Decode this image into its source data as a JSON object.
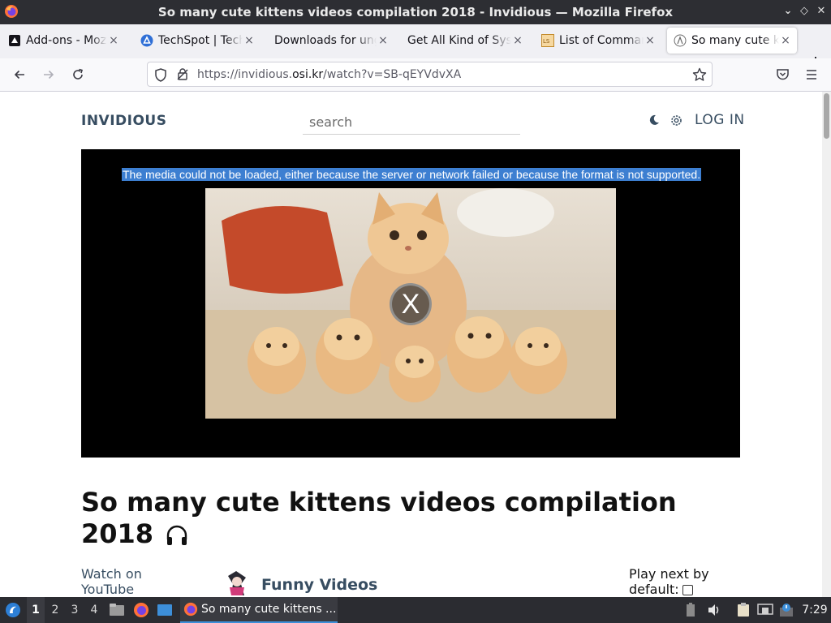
{
  "window": {
    "title": "So many cute kittens videos compilation 2018 - Invidious — Mozilla Firefox",
    "minimize": "⌄",
    "restore": "◇",
    "close": "✕"
  },
  "tabs": [
    {
      "label": "Add-ons - Mozilla",
      "icon": "addons-icon",
      "active": false
    },
    {
      "label": "TechSpot | Technology",
      "icon": "techspot-icon",
      "active": false
    },
    {
      "label": "Downloads for ungoogled",
      "icon": "none",
      "active": false
    },
    {
      "label": "Get All Kind of System",
      "icon": "none",
      "active": false
    },
    {
      "label": "List of Commands",
      "icon": "ls-icon",
      "active": false
    },
    {
      "label": "So many cute kittens",
      "icon": "invidious-icon",
      "active": true
    }
  ],
  "tab_close_glyph": "×",
  "new_tab": "+",
  "navbar": {
    "url_prefix": "https://invidious.",
    "url_domain": "osi.kr",
    "url_suffix": "/watch?v=SB-qEYVdvXA"
  },
  "site": {
    "logo": "INVIDIOUS",
    "search_placeholder": "search",
    "login": "LOG IN"
  },
  "player": {
    "error_message": "The media could not be loaded, either because the server or network failed or because the format is not supported.",
    "error_glyph": "X"
  },
  "video": {
    "title": "So many cute kittens videos compilation 2018",
    "watch_on_youtube": "Watch on YouTube",
    "channel_name": "Funny Videos",
    "play_next_label": "Play next by default:"
  },
  "taskbar": {
    "workspaces": [
      "1",
      "2",
      "3",
      "4"
    ],
    "active_workspace": 0,
    "window_label": "So many cute kittens ...",
    "clock": "7:29"
  },
  "colors": {
    "accent_link": "#374d61",
    "selection": "#3d7fd1",
    "taskbar_bg": "#2b2c31"
  }
}
